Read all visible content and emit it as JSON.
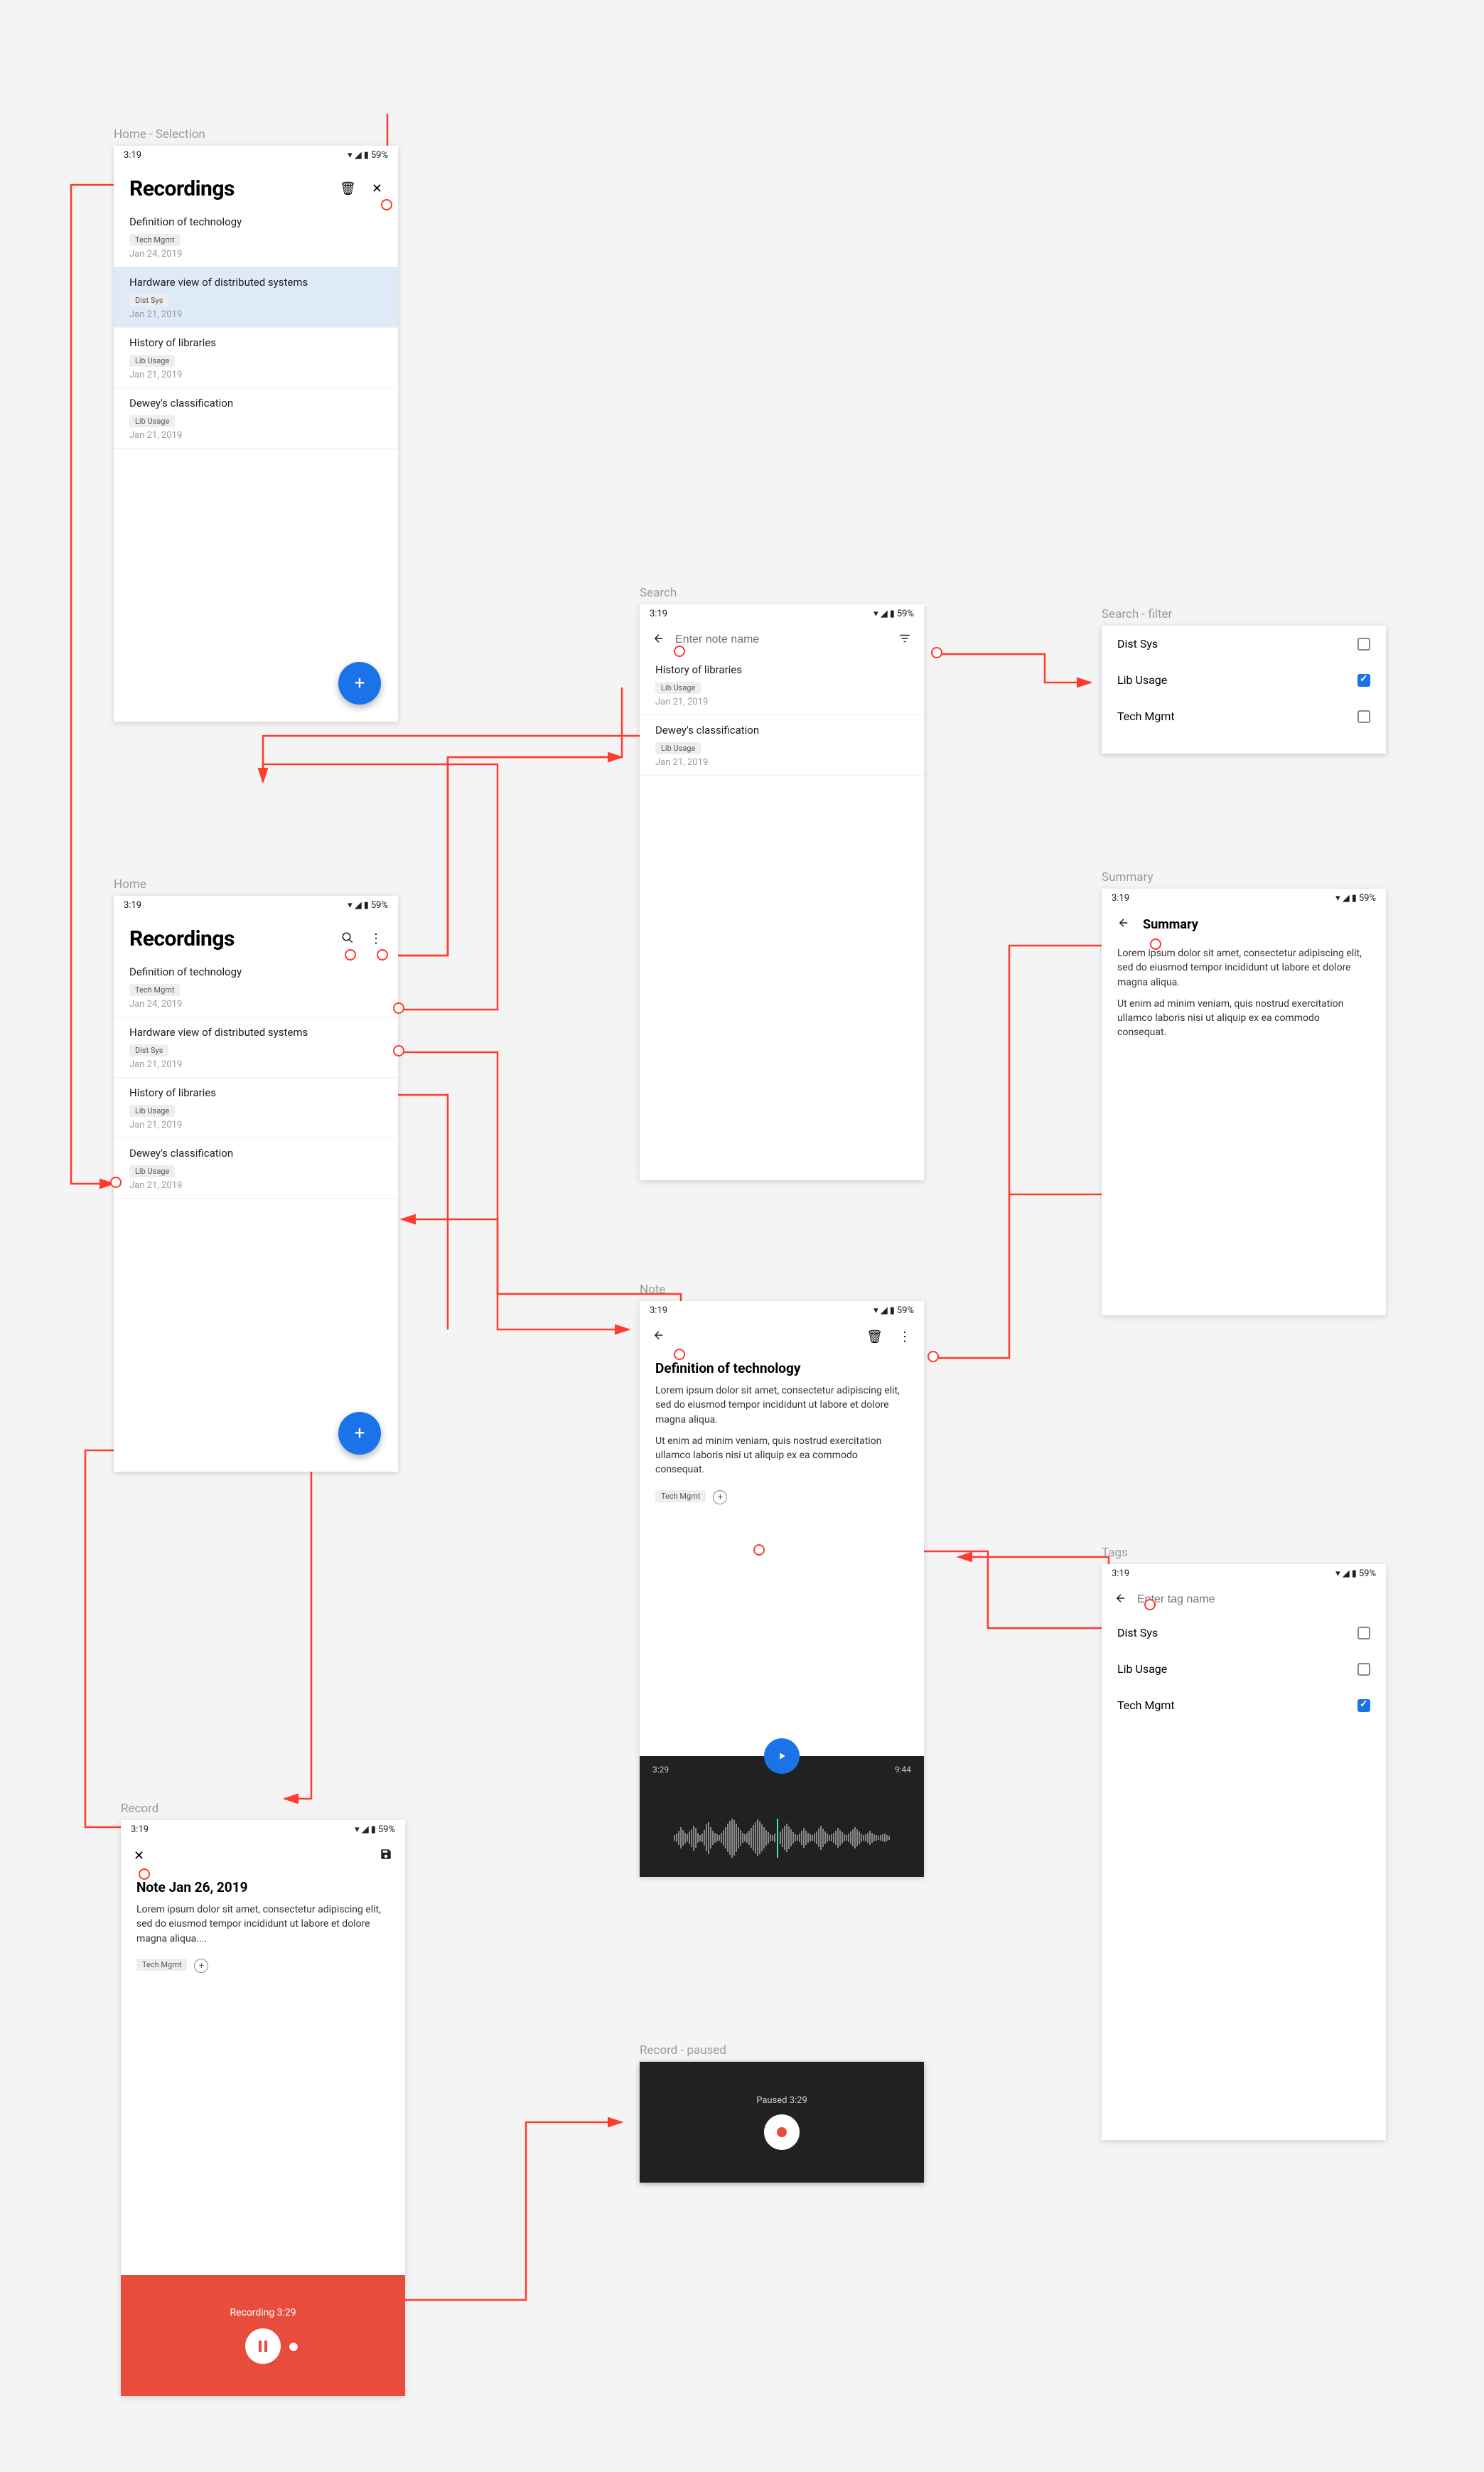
{
  "status": {
    "time": "3:19",
    "batt": "59%"
  },
  "screens": {
    "home_selection": {
      "label": "Home - Selection",
      "title": "Recordings",
      "items": [
        {
          "title": "Definition of technology",
          "tag": "Tech Mgmt",
          "date": "Jan 24, 2019",
          "selected": false
        },
        {
          "title": "Hardware view of distributed systems",
          "tag": "Dist Sys",
          "date": "Jan 21, 2019",
          "selected": true
        },
        {
          "title": "History of libraries",
          "tag": "Lib Usage",
          "date": "Jan 21, 2019",
          "selected": false
        },
        {
          "title": "Dewey's classification",
          "tag": "Lib Usage",
          "date": "Jan 21, 2019",
          "selected": false
        }
      ]
    },
    "home": {
      "label": "Home",
      "title": "Recordings",
      "items": [
        {
          "title": "Definition of technology",
          "tag": "Tech Mgmt",
          "date": "Jan 24, 2019"
        },
        {
          "title": "Hardware view of distributed systems",
          "tag": "Dist Sys",
          "date": "Jan 21, 2019"
        },
        {
          "title": "History of libraries",
          "tag": "Lib Usage",
          "date": "Jan 21, 2019"
        },
        {
          "title": "Dewey's classification",
          "tag": "Lib Usage",
          "date": "Jan 21, 2019"
        }
      ]
    },
    "search": {
      "label": "Search",
      "placeholder": "Enter note name",
      "items": [
        {
          "title": "History of libraries",
          "tag": "Lib Usage",
          "date": "Jan 21, 2019"
        },
        {
          "title": "Dewey's classification",
          "tag": "Lib Usage",
          "date": "Jan 21, 2019"
        }
      ]
    },
    "search_filter": {
      "label": "Search - filter",
      "options": [
        {
          "label": "Dist Sys",
          "checked": false
        },
        {
          "label": "Lib Usage",
          "checked": true
        },
        {
          "label": "Tech Mgmt",
          "checked": false
        }
      ]
    },
    "summary": {
      "label": "Summary",
      "title": "Summary",
      "p1": "Lorem ipsum dolor sit amet, consectetur adipiscing elit, sed do eiusmod tempor incididunt ut labore et dolore magna aliqua.",
      "p2": "Ut enim ad minim veniam, quis nostrud exercitation ullamco laboris nisi ut aliquip ex ea commodo consequat."
    },
    "note": {
      "label": "Note",
      "title": "Definition of technology",
      "p1": "Lorem ipsum dolor sit amet, consectetur adipiscing elit, sed do eiusmod tempor incididunt ut labore et dolore magna aliqua.",
      "p2": "Ut enim ad minim veniam, quis nostrud exercitation ullamco laboris nisi ut aliquip ex ea commodo consequat.",
      "tag": "Tech Mgmt",
      "player": {
        "current": "3:29",
        "total": "9:44"
      }
    },
    "tags": {
      "label": "Tags",
      "placeholder": "Enter tag name",
      "options": [
        {
          "label": "Dist Sys",
          "checked": false
        },
        {
          "label": "Lib Usage",
          "checked": false
        },
        {
          "label": "Tech Mgmt",
          "checked": true
        }
      ]
    },
    "record": {
      "label": "Record",
      "title": "Note Jan 26, 2019",
      "body": "Lorem ipsum dolor sit amet, consectetur adipiscing elit, sed do eiusmod tempor incididunt ut labore et dolore magna aliqua....",
      "tag": "Tech Mgmt",
      "bar_label": "Recording 3:29"
    },
    "record_paused": {
      "label": "Record - paused",
      "bar_label": "Paused 3:29"
    }
  }
}
